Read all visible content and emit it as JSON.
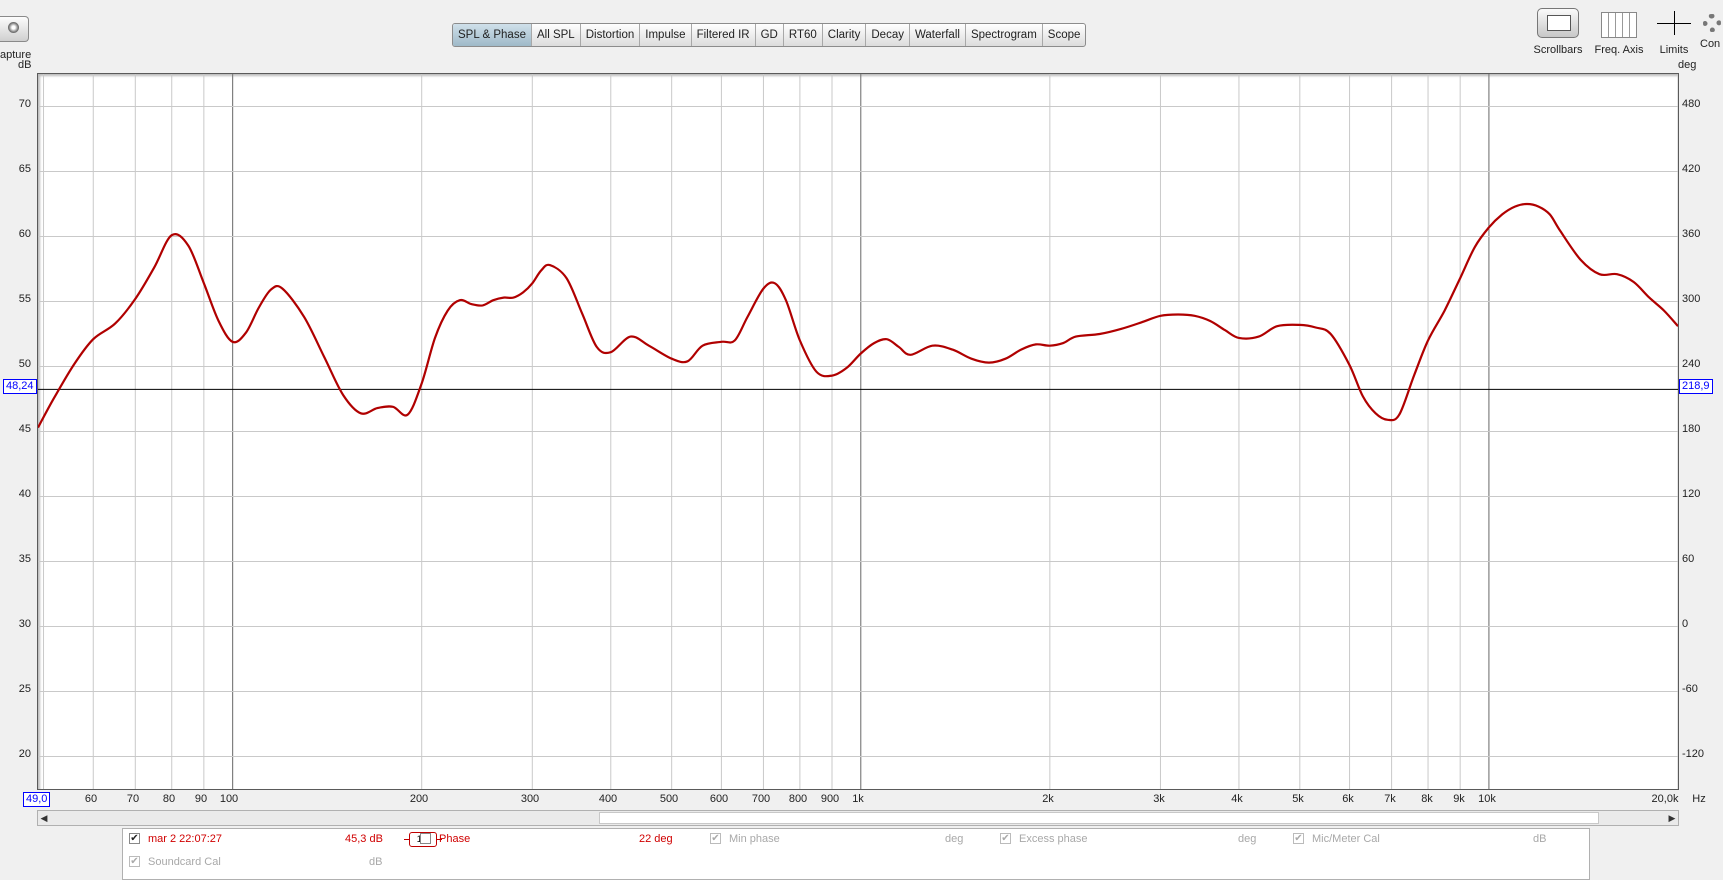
{
  "toolbar": {
    "capture_label": "apture",
    "tabs": [
      "SPL & Phase",
      "All SPL",
      "Distortion",
      "Impulse",
      "Filtered IR",
      "GD",
      "RT60",
      "Clarity",
      "Decay",
      "Waterfall",
      "Spectrogram",
      "Scope"
    ],
    "active_tab": "SPL & Phase",
    "right_tools": {
      "scrollbars": "Scrollbars",
      "freq_axis": "Freq. Axis",
      "limits": "Limits",
      "comp": "Con"
    }
  },
  "axes": {
    "left_unit": "dB",
    "right_unit": "deg",
    "x_unit_suffix": "Hz",
    "left_cursor_value": "48,24",
    "right_cursor_value": "218,9",
    "x_cursor_value": "49,0"
  },
  "chart_data": {
    "type": "line",
    "title": "",
    "xlabel": "Hz",
    "ylabel": "dB",
    "y2label": "deg",
    "x_scale": "log",
    "xlim": [
      49,
      20000
    ],
    "ylim": [
      17.5,
      72.5
    ],
    "y2lim": [
      -142.5,
      517.5
    ],
    "y_ticks": [
      "70",
      "65",
      "60",
      "55",
      "50",
      "45",
      "40",
      "35",
      "30",
      "25",
      "20"
    ],
    "y2_ticks": [
      "480",
      "420",
      "360",
      "300",
      "240",
      "180",
      "120",
      "60",
      "0",
      "-60",
      "-120"
    ],
    "x_ticks": [
      "60",
      "70",
      "80",
      "90",
      "100",
      "200",
      "300",
      "400",
      "500",
      "600",
      "700",
      "800",
      "900",
      "1k",
      "2k",
      "3k",
      "4k",
      "5k",
      "6k",
      "7k",
      "8k",
      "9k",
      "10k",
      "20,0k"
    ],
    "grid": true,
    "cursor_line_db": 48.24,
    "series": [
      {
        "name": "mar 2 22:07:27",
        "color": "#b00000",
        "x": [
          49,
          52,
          56,
          60,
          65,
          70,
          75,
          80,
          85,
          90,
          95,
          100,
          105,
          110,
          115,
          120,
          130,
          140,
          150,
          160,
          170,
          180,
          190,
          200,
          210,
          220,
          230,
          240,
          250,
          260,
          270,
          280,
          290,
          300,
          310,
          320,
          340,
          360,
          380,
          400,
          430,
          460,
          500,
          530,
          560,
          600,
          630,
          660,
          700,
          730,
          760,
          800,
          850,
          900,
          950,
          1000,
          1050,
          1100,
          1150,
          1200,
          1300,
          1400,
          1500,
          1600,
          1700,
          1800,
          1900,
          2000,
          2100,
          2200,
          2400,
          2600,
          2800,
          3000,
          3200,
          3400,
          3600,
          3800,
          4000,
          4300,
          4600,
          5000,
          5300,
          5600,
          6000,
          6300,
          6600,
          6900,
          7200,
          7600,
          8000,
          8500,
          9000,
          9500,
          10000,
          10500,
          11000,
          11500,
          12000,
          12500,
          13000,
          14000,
          15000,
          16000,
          17000,
          18000,
          19000,
          20000
        ],
        "values": [
          45.3,
          47.6,
          50.2,
          52.1,
          53.3,
          55.2,
          57.6,
          60.1,
          59.3,
          56.4,
          53.5,
          51.9,
          52.6,
          54.5,
          55.9,
          56.0,
          53.8,
          50.7,
          47.8,
          46.4,
          46.8,
          46.9,
          46.3,
          48.7,
          52.2,
          54.3,
          55.1,
          54.8,
          54.7,
          55.1,
          55.3,
          55.3,
          55.7,
          56.4,
          57.4,
          57.8,
          56.8,
          54.1,
          51.5,
          51.1,
          52.3,
          51.6,
          50.6,
          50.4,
          51.6,
          51.9,
          52.0,
          53.8,
          56.0,
          56.4,
          55.1,
          52.0,
          49.6,
          49.3,
          49.9,
          51.0,
          51.8,
          52.1,
          51.5,
          50.9,
          51.6,
          51.3,
          50.6,
          50.3,
          50.6,
          51.3,
          51.7,
          51.6,
          51.8,
          52.3,
          52.5,
          52.9,
          53.4,
          53.9,
          54.0,
          53.9,
          53.5,
          52.8,
          52.2,
          52.3,
          53.1,
          53.2,
          53.0,
          52.5,
          50.1,
          47.7,
          46.4,
          45.9,
          46.3,
          49.3,
          52.0,
          54.3,
          56.8,
          59.2,
          60.7,
          61.7,
          62.3,
          62.5,
          62.3,
          61.7,
          60.4,
          58.2,
          57.1,
          57.1,
          56.5,
          55.3,
          54.3,
          53.1
        ]
      }
    ]
  },
  "scrollbar": {
    "left_arrow": "◀",
    "right_arrow": "▶"
  },
  "legend": {
    "measurement_name": "mar 2 22:07:27",
    "smoothing": "1/6",
    "level": "45,3 dB",
    "phase_label": "Phase",
    "phase_value": "22 deg",
    "min_phase_label": "Min phase",
    "min_phase_unit": "deg",
    "excess_phase_label": "Excess phase",
    "excess_phase_unit": "deg",
    "mic_cal_label": "Mic/Meter Cal",
    "mic_cal_unit": "dB",
    "soundcard_cal_label": "Soundcard Cal",
    "soundcard_cal_unit": "dB"
  }
}
